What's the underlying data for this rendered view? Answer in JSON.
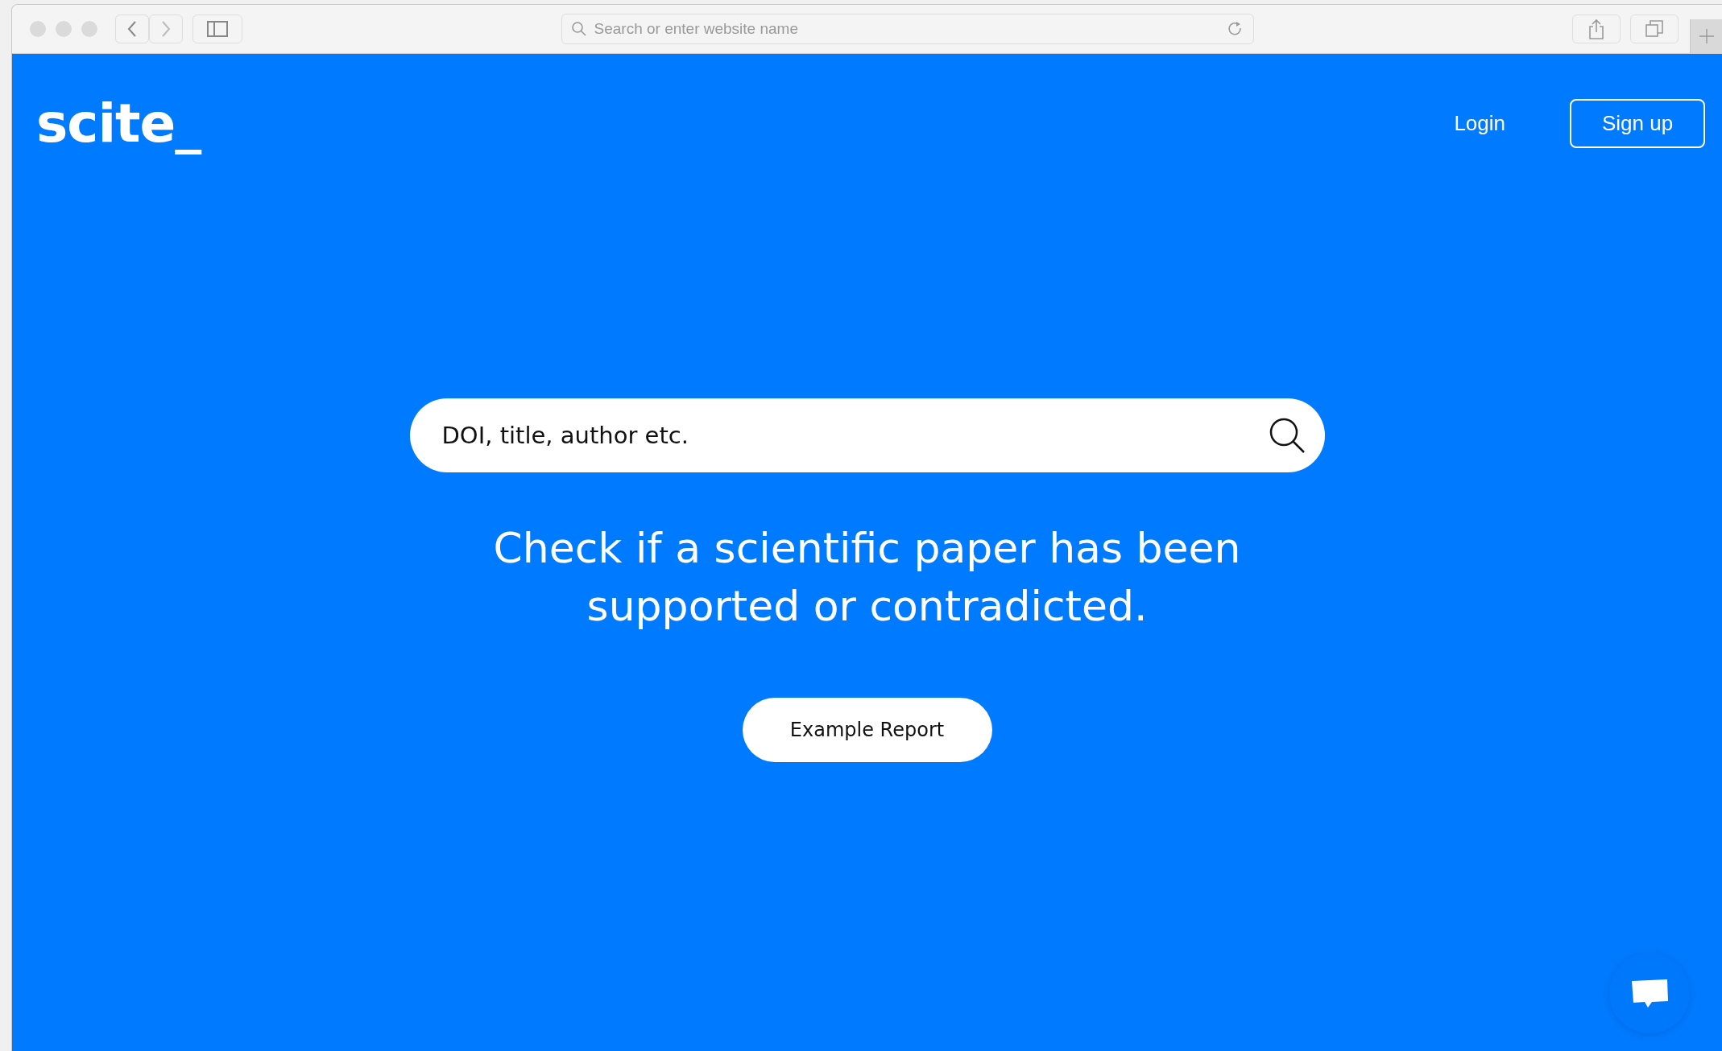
{
  "browser": {
    "address_placeholder": "Search or enter website name"
  },
  "header": {
    "logo": "scite_",
    "login": "Login",
    "signup": "Sign up"
  },
  "search": {
    "placeholder": "DOI, title, author etc."
  },
  "headline": [
    "Check if a scientific paper has been",
    "supported or contradicted."
  ],
  "example_button": "Example Report"
}
